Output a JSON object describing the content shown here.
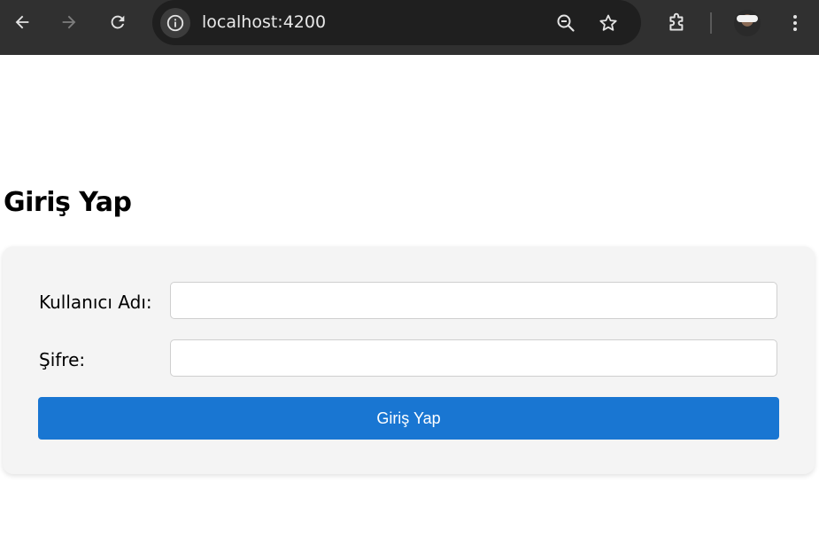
{
  "browser": {
    "url": "localhost:4200",
    "icons": {
      "back": "back-arrow-icon",
      "forward": "forward-arrow-icon",
      "reload": "reload-icon",
      "site_info": "info-icon",
      "zoom": "zoom-out-icon",
      "bookmark": "star-icon",
      "extensions": "puzzle-icon",
      "menu": "kebab-menu-icon"
    }
  },
  "page": {
    "title": "Giriş Yap"
  },
  "form": {
    "username_label": "Kullanıcı Adı:",
    "username_value": "",
    "password_label": "Şifre:",
    "password_value": "",
    "submit_label": "Giriş Yap"
  },
  "colors": {
    "chrome_bg": "#303030",
    "omnibox_bg": "#1f1f1f",
    "card_bg": "#f4f4f4",
    "accent": "#1976d2"
  }
}
